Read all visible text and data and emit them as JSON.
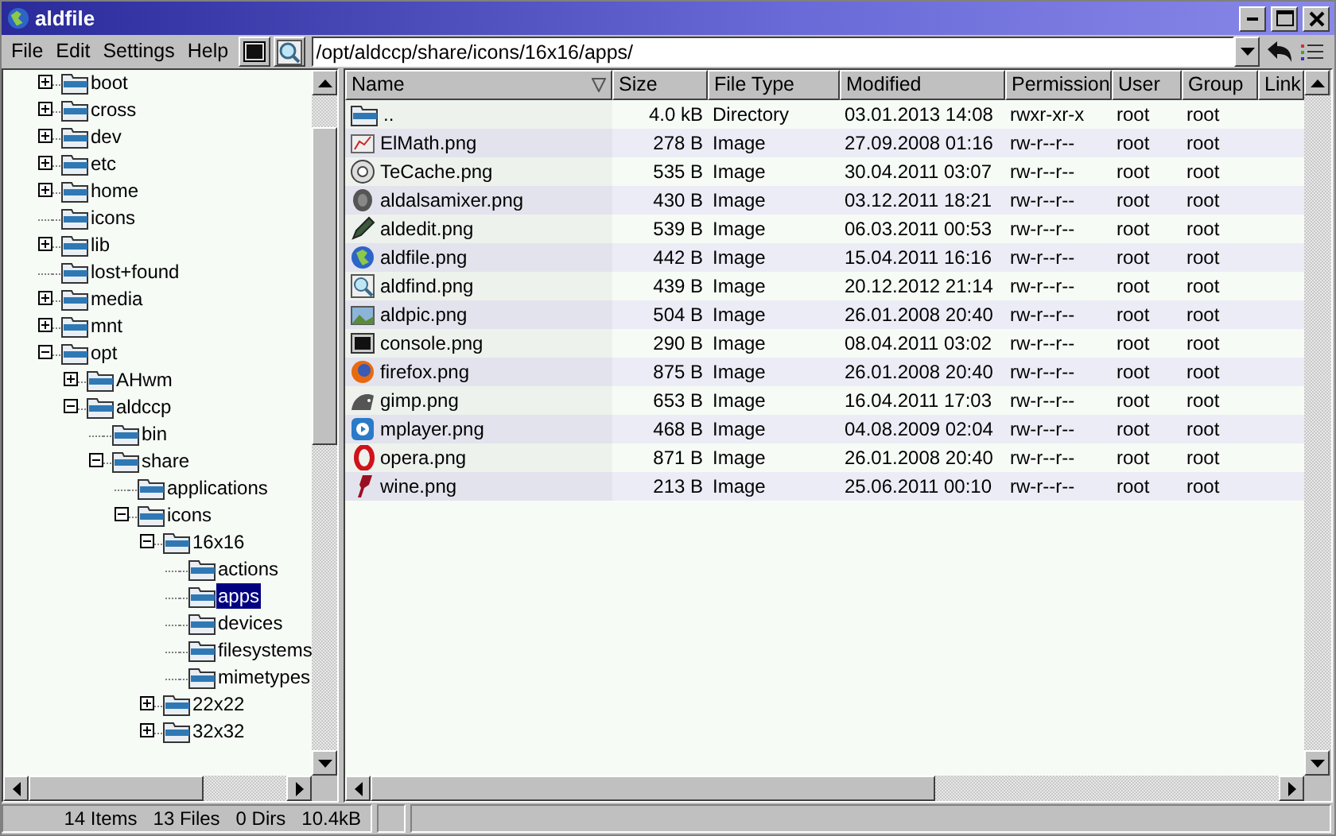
{
  "window": {
    "title": "aldfile"
  },
  "menu": [
    "File",
    "Edit",
    "Settings",
    "Help"
  ],
  "address": {
    "value": "/opt/aldccp/share/icons/16x16/apps/"
  },
  "tree": [
    {
      "label": "boot",
      "expanded": false,
      "selected": false
    },
    {
      "label": "cross",
      "expanded": false,
      "selected": false
    },
    {
      "label": "dev",
      "expanded": false,
      "selected": false
    },
    {
      "label": "etc",
      "expanded": false,
      "selected": false
    },
    {
      "label": "home",
      "expanded": false,
      "selected": false
    },
    {
      "label": "icons",
      "selected": false
    },
    {
      "label": "lib",
      "expanded": false,
      "selected": false
    },
    {
      "label": "lost+found",
      "selected": false
    },
    {
      "label": "media",
      "expanded": false,
      "selected": false
    },
    {
      "label": "mnt",
      "expanded": false,
      "selected": false
    },
    {
      "label": "opt",
      "expanded": true,
      "selected": false,
      "children": [
        {
          "label": "AHwm",
          "expanded": false,
          "selected": false
        },
        {
          "label": "aldccp",
          "expanded": true,
          "selected": false,
          "children": [
            {
              "label": "bin",
              "selected": false
            },
            {
              "label": "share",
              "expanded": true,
              "selected": false,
              "children": [
                {
                  "label": "applications",
                  "selected": false
                },
                {
                  "label": "icons",
                  "expanded": true,
                  "selected": false,
                  "children": [
                    {
                      "label": "16x16",
                      "expanded": true,
                      "selected": false,
                      "children": [
                        {
                          "label": "actions",
                          "selected": false
                        },
                        {
                          "label": "apps",
                          "selected": true
                        },
                        {
                          "label": "devices",
                          "selected": false
                        },
                        {
                          "label": "filesystems",
                          "selected": false
                        },
                        {
                          "label": "mimetypes",
                          "selected": false
                        }
                      ]
                    },
                    {
                      "label": "22x22",
                      "expanded": false,
                      "selected": false
                    },
                    {
                      "label": "32x32",
                      "expanded": false,
                      "selected": false
                    }
                  ]
                }
              ]
            }
          ]
        }
      ]
    }
  ],
  "table": {
    "columns": [
      "Name",
      "Size",
      "File Type",
      "Modified",
      "Permission",
      "User",
      "Group",
      "Link"
    ],
    "rows": [
      [
        "..",
        "4.0 kB",
        "Directory",
        "03.01.2013 14:08",
        "rwxr-xr-x",
        "root",
        "root"
      ],
      [
        "ElMath.png",
        "278 B",
        "Image",
        "27.09.2008 01:16",
        "rw-r--r--",
        "root",
        "root"
      ],
      [
        "TeCache.png",
        "535 B",
        "Image",
        "30.04.2011 03:07",
        "rw-r--r--",
        "root",
        "root"
      ],
      [
        "aldalsamixer.png",
        "430 B",
        "Image",
        "03.12.2011 18:21",
        "rw-r--r--",
        "root",
        "root"
      ],
      [
        "aldedit.png",
        "539 B",
        "Image",
        "06.03.2011 00:53",
        "rw-r--r--",
        "root",
        "root"
      ],
      [
        "aldfile.png",
        "442 B",
        "Image",
        "15.04.2011 16:16",
        "rw-r--r--",
        "root",
        "root"
      ],
      [
        "aldfind.png",
        "439 B",
        "Image",
        "20.12.2012 21:14",
        "rw-r--r--",
        "root",
        "root"
      ],
      [
        "aldpic.png",
        "504 B",
        "Image",
        "26.01.2008 20:40",
        "rw-r--r--",
        "root",
        "root"
      ],
      [
        "console.png",
        "290 B",
        "Image",
        "08.04.2011 03:02",
        "rw-r--r--",
        "root",
        "root"
      ],
      [
        "firefox.png",
        "875 B",
        "Image",
        "26.01.2008 20:40",
        "rw-r--r--",
        "root",
        "root"
      ],
      [
        "gimp.png",
        "653 B",
        "Image",
        "16.04.2011 17:03",
        "rw-r--r--",
        "root",
        "root"
      ],
      [
        "mplayer.png",
        "468 B",
        "Image",
        "04.08.2009 02:04",
        "rw-r--r--",
        "root",
        "root"
      ],
      [
        "opera.png",
        "871 B",
        "Image",
        "26.01.2008 20:40",
        "rw-r--r--",
        "root",
        "root"
      ],
      [
        "wine.png",
        "213 B",
        "Image",
        "25.06.2011 00:10",
        "rw-r--r--",
        "root",
        "root"
      ]
    ]
  },
  "status_bar": [
    "14 Items",
    "13 Files",
    "0 Dirs",
    "10.4kB"
  ]
}
